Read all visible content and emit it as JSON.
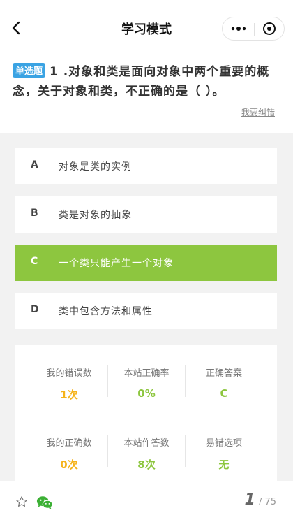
{
  "nav": {
    "title": "学习模式"
  },
  "question": {
    "type_badge": "单选题",
    "line1": "1 .对象和类是面向对象中两个重要的概",
    "line2": "念，关于对象和类，不正确的是（ ）。",
    "report_label": "我要纠错"
  },
  "options": [
    {
      "letter": "A",
      "text": "对象是类的实例",
      "selected": false
    },
    {
      "letter": "B",
      "text": "类是对象的抽象",
      "selected": false
    },
    {
      "letter": "C",
      "text": "一个类只能产生一个对象",
      "selected": true
    },
    {
      "letter": "D",
      "text": "类中包含方法和属性",
      "selected": false
    }
  ],
  "stats": [
    {
      "label": "我的错误数",
      "value": "1次",
      "color": "#f5b31b"
    },
    {
      "label": "本站正确率",
      "value": "0%",
      "color": "#8dc63f"
    },
    {
      "label": "正确答案",
      "value": "C",
      "color": "#8dc63f"
    },
    {
      "label": "我的正确数",
      "value": "0次",
      "color": "#f5b31b"
    },
    {
      "label": "本站作答数",
      "value": "8次",
      "color": "#8dc63f"
    },
    {
      "label": "易错选项",
      "value": "无",
      "color": "#8dc63f"
    }
  ],
  "pager": {
    "current": "1",
    "total": "/ 75"
  },
  "icons": {
    "back": "chevron-left-icon",
    "more": "more-dots-icon",
    "close": "target-circle-icon",
    "favorite": "star-icon",
    "share": "wechat-icon"
  },
  "colors": {
    "accent_green": "#8dc63f",
    "badge_blue": "#3aa3e3",
    "warning_orange": "#f5b31b"
  }
}
